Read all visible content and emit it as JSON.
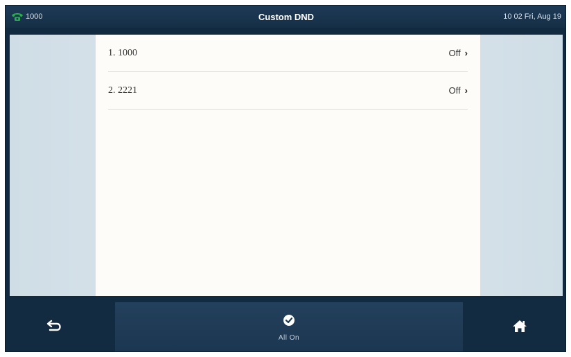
{
  "status_bar": {
    "account": "1000",
    "title": "Custom DND",
    "datetime": "10 02 Fri, Aug 19",
    "phone_icon": "handset-icon",
    "phone_icon_color": "#27b04a"
  },
  "list": {
    "items": [
      {
        "label": "1. 1000",
        "value": "Off"
      },
      {
        "label": "2. 2221",
        "value": "Off"
      }
    ]
  },
  "softkeys": {
    "back_icon": "back-arrow-icon",
    "center_icon": "check-circle-icon",
    "center_label": "All On",
    "home_icon": "home-icon"
  },
  "chevron_glyph": "›"
}
